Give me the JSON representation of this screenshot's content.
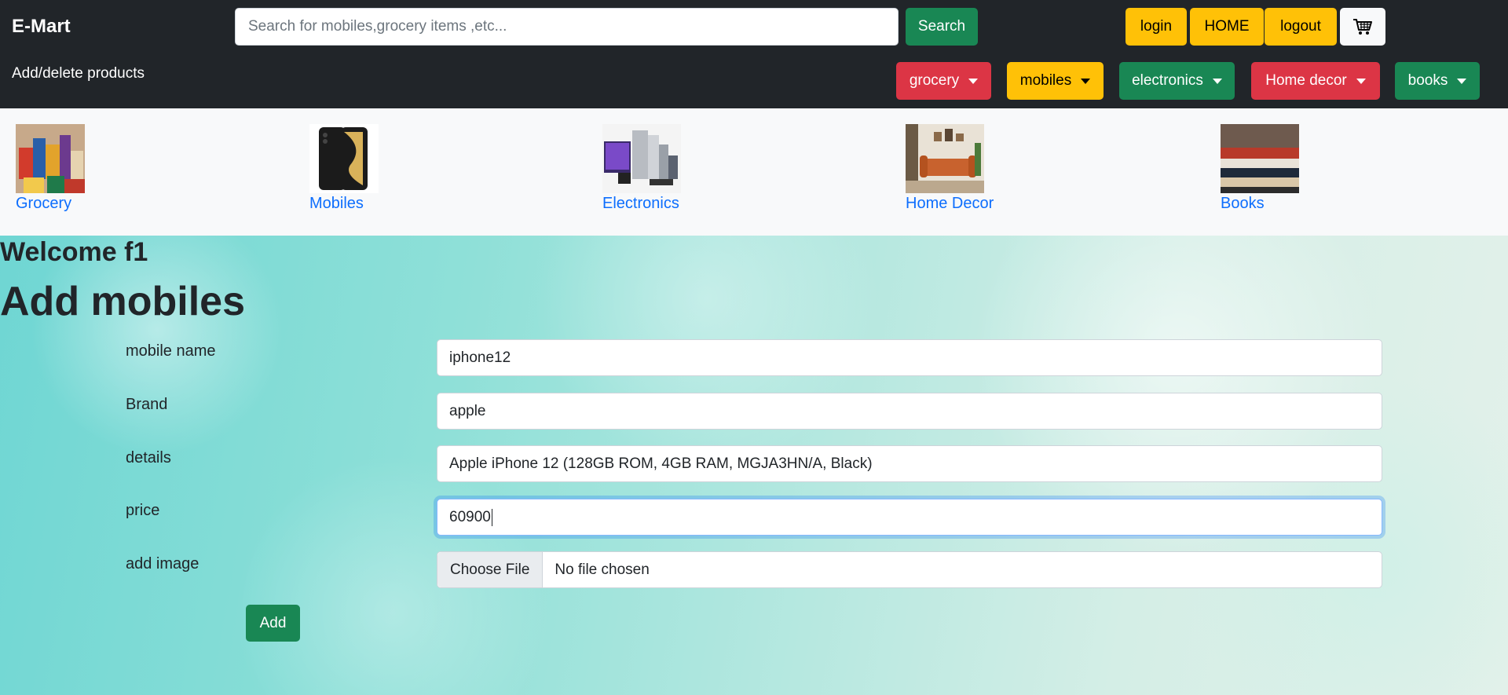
{
  "navbar": {
    "brand": "E-Mart",
    "sublink": "Add/delete products",
    "search_placeholder": "Search for mobiles,grocery items ,etc...",
    "search_button": "Search",
    "login": "login",
    "home": "HOME",
    "logout": "logout",
    "cart_icon": "cart-icon",
    "dropdowns": [
      "grocery",
      "mobiles",
      "electronics",
      "Home decor",
      "books"
    ]
  },
  "categories": [
    {
      "label": "Grocery"
    },
    {
      "label": "Mobiles"
    },
    {
      "label": "Electronics"
    },
    {
      "label": "Home Decor"
    },
    {
      "label": "Books"
    }
  ],
  "main": {
    "welcome": "Welcome f1",
    "title": "Add mobiles",
    "fields": {
      "name_label": "mobile name",
      "name_value": "iphone12",
      "brand_label": "Brand",
      "brand_value": "apple",
      "details_label": "details",
      "details_value": "Apple iPhone 12 (128GB ROM, 4GB RAM, MGJA3HN/A, Black)",
      "price_label": "price",
      "price_value": "60900",
      "image_label": "add image",
      "file_button": "Choose File",
      "file_status": "No file chosen"
    },
    "add_button": "Add"
  },
  "colors": {
    "navbar_bg": "#212529",
    "success": "#198754",
    "warning": "#ffc107",
    "danger": "#dc3545",
    "link": "#0d6efd"
  }
}
